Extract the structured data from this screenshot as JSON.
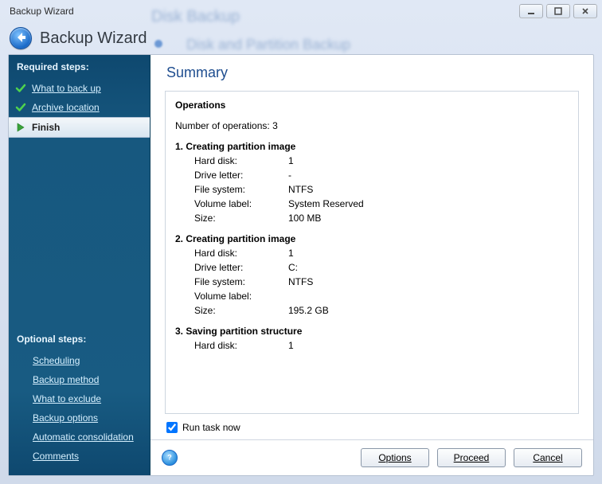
{
  "window": {
    "title": "Backup Wizard"
  },
  "header": {
    "title": "Backup Wizard"
  },
  "sidebar": {
    "required_heading": "Required steps:",
    "required_items": [
      {
        "label": "What to back up",
        "state": "done"
      },
      {
        "label": "Archive location",
        "state": "done"
      },
      {
        "label": "Finish",
        "state": "current"
      }
    ],
    "optional_heading": "Optional steps:",
    "optional_items": [
      {
        "label": "Scheduling"
      },
      {
        "label": "Backup method"
      },
      {
        "label": "What to exclude"
      },
      {
        "label": "Backup options"
      },
      {
        "label": "Automatic consolidation"
      },
      {
        "label": "Comments"
      }
    ]
  },
  "content": {
    "heading": "Summary",
    "operations_heading": "Operations",
    "num_operations_label": "Number of operations: 3",
    "ops": [
      {
        "title": "1. Creating partition image",
        "rows": [
          {
            "label": "Hard disk:",
            "value": "1"
          },
          {
            "label": "Drive letter:",
            "value": "-"
          },
          {
            "label": "File system:",
            "value": "NTFS"
          },
          {
            "label": "Volume label:",
            "value": "System Reserved"
          },
          {
            "label": "Size:",
            "value": "100 MB"
          }
        ]
      },
      {
        "title": "2. Creating partition image",
        "rows": [
          {
            "label": "Hard disk:",
            "value": "1"
          },
          {
            "label": "Drive letter:",
            "value": "C:"
          },
          {
            "label": "File system:",
            "value": "NTFS"
          },
          {
            "label": "Volume label:",
            "value": ""
          },
          {
            "label": "Size:",
            "value": "195.2 GB"
          }
        ]
      },
      {
        "title": "3. Saving partition structure",
        "rows": [
          {
            "label": "Hard disk:",
            "value": "1"
          }
        ]
      }
    ],
    "run_task_label": "Run task now",
    "run_task_checked": true
  },
  "footer": {
    "buttons": {
      "options": "Options",
      "proceed": "Proceed",
      "cancel": "Cancel"
    }
  }
}
